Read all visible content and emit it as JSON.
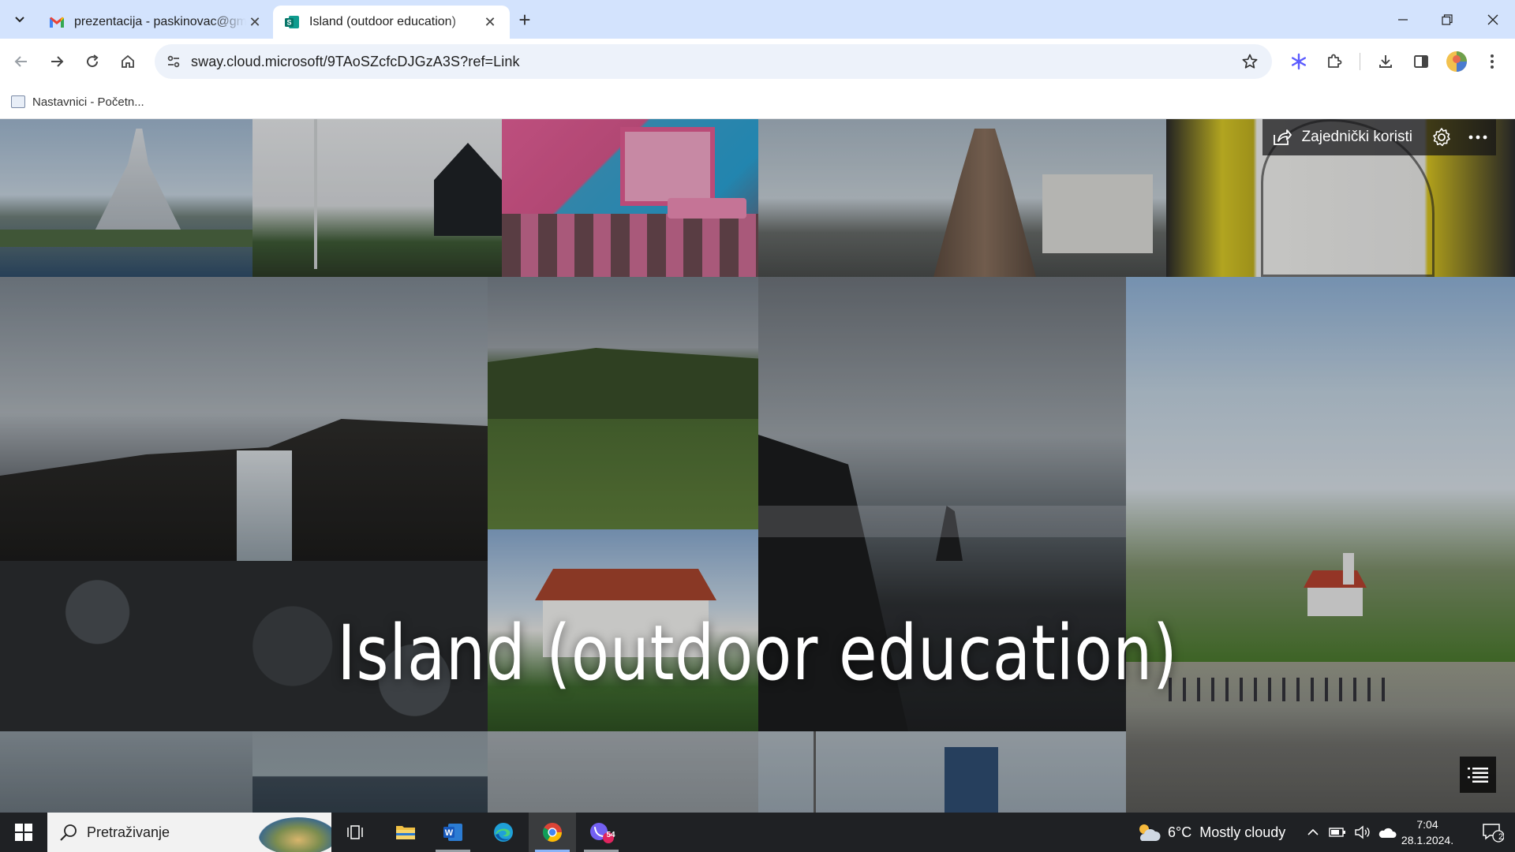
{
  "browser": {
    "tabs": [
      {
        "title": "prezentacija - paskinovac@gmail.com - Gmail",
        "favicon": "gmail-icon",
        "active": false
      },
      {
        "title": "Island (outdoor education)",
        "favicon": "sway-icon",
        "active": true
      }
    ],
    "url": "sway.cloud.microsoft/9TAoSZcfcDJGzA3S?ref=Link",
    "bookmarks": [
      {
        "label": "Nastavnici - Početn..."
      }
    ]
  },
  "sway": {
    "share_label": "Zajednički koristi",
    "title": "Island (outdoor education)"
  },
  "taskbar": {
    "search_placeholder": "Pretraživanje",
    "weather_temp": "6°C",
    "weather_desc": "Mostly cloudy",
    "time": "7:04",
    "date": "28.1.2024.",
    "viber_badge": "54",
    "notifications": "2"
  },
  "colors": {
    "tabstrip": "#d3e3fd",
    "omnibox": "#edf2fa",
    "taskbar": "#1f2124",
    "accent": "#8ab4f8"
  }
}
